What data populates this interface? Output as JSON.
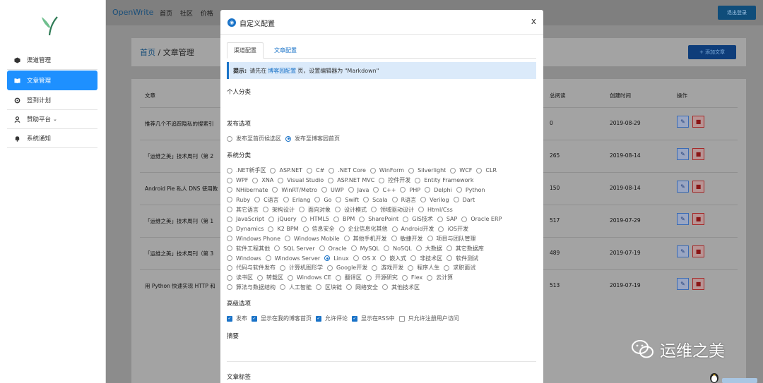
{
  "sidebar": {
    "items": [
      {
        "label": "渠道管理",
        "icon": "cube-icon"
      },
      {
        "label": "文章管理",
        "icon": "book-icon"
      },
      {
        "label": "签到计划",
        "icon": "cog-icon"
      },
      {
        "label": "赞助平台",
        "icon": "user-icon"
      },
      {
        "label": "系统通知",
        "icon": "bell-icon"
      }
    ]
  },
  "topbar": {
    "brand": "OpenWrite",
    "nav": [
      "首页",
      "社区",
      "价格"
    ],
    "logout": "退出登录"
  },
  "page": {
    "breadcrumb_home": "首页",
    "breadcrumb_sep": " / ",
    "breadcrumb_current": "文章管理",
    "add_button": "+ 添加文章"
  },
  "table": {
    "headers": {
      "title": "文章",
      "views": "总阅读",
      "created": "创建时间",
      "actions": "操作"
    },
    "rows": [
      {
        "title": "推荐几个不追踪隐私的搜索引",
        "views": "0",
        "date": "2019-08-29"
      },
      {
        "title": "「运维之美」技术周刊（第 2",
        "views": "265",
        "date": "2019-08-14"
      },
      {
        "title": "Android Pie 私人 DNS 使用教",
        "views": "150",
        "date": "2019-08-14"
      },
      {
        "title": "「运维之美」技术周刊（第 1",
        "views": "517",
        "date": "2019-07-29"
      },
      {
        "title": "「运维之美」技术周刊（第 3",
        "views": "489",
        "date": "2019-07-19"
      },
      {
        "title": "用 Python 快速实现 HTTP 和",
        "views": "513",
        "date": "2019-07-19"
      }
    ]
  },
  "modal": {
    "title": "自定义配置",
    "close": "x",
    "tabs": [
      "渠道配置",
      "文章配置"
    ],
    "tip_label": "提示:",
    "tip_pre": "请先在",
    "tip_link": "博客园配置",
    "tip_post": "页，设置编辑器为 \"Markdown\"",
    "personal_category": "个人分类",
    "publish_options": "发布选项",
    "publish_radios": [
      {
        "label": "发布至首页候选区",
        "checked": false
      },
      {
        "label": "发布至博客园首页",
        "checked": true
      }
    ],
    "system_category": "系统分类",
    "system_lines": [
      [
        ".NET新手区",
        "ASP.NET",
        "C#",
        ".NET Core",
        "WinForm",
        "Silverlight",
        "WCF",
        "CLR"
      ],
      [
        "WPF",
        "XNA",
        "Visual Studio",
        "ASP.NET MVC",
        "控件开发",
        "Entity Framework"
      ],
      [
        "NHibernate",
        "WinRT/Metro",
        "UWP",
        "Java",
        "C++",
        "PHP",
        "Delphi",
        "Python"
      ],
      [
        "Ruby",
        "C语言",
        "Erlang",
        "Go",
        "Swift",
        "Scala",
        "R语言",
        "Verilog",
        "Dart"
      ],
      [
        "其它语言",
        "架构设计",
        "面向对象",
        "设计模式",
        "领域驱动设计",
        "Html/Css"
      ],
      [
        "JavaScript",
        "jQuery",
        "HTML5",
        "BPM",
        "SharePoint",
        "GIS技术",
        "SAP",
        "Oracle ERP"
      ],
      [
        "Dynamics",
        "K2 BPM",
        "信息安全",
        "企业信息化其他",
        "Android开发",
        "iOS开发"
      ],
      [
        "Windows Phone",
        "Windows Mobile",
        "其他手机开发",
        "敏捷开发",
        "项目与团队管理"
      ],
      [
        "软件工程其他",
        "SQL Server",
        "Oracle",
        "MySQL",
        "NoSQL",
        "大数据",
        "其它数据库"
      ],
      [
        "Windows",
        "Windows Server",
        "Linux",
        "OS X",
        "嵌入式",
        "非技术区",
        "软件测试"
      ],
      [
        "代码与软件发布",
        "计算机图形学",
        "Google开发",
        "游戏开发",
        "程序人生",
        "求职面试"
      ],
      [
        "读书区",
        "转载区",
        "Windows CE",
        "翻译区",
        "开源研究",
        "Flex",
        "云计算"
      ],
      [
        "算法与数据结构",
        "人工智能",
        "区块链",
        "网络安全",
        "其他技术区"
      ]
    ],
    "system_checked": "Linux",
    "advanced": "高级选项",
    "advanced_checks": [
      {
        "label": "发布",
        "checked": true
      },
      {
        "label": "显示在我的博客首页",
        "checked": true
      },
      {
        "label": "允许评论",
        "checked": true
      },
      {
        "label": "显示在RSS中",
        "checked": true
      },
      {
        "label": "只允许注册用户访问",
        "checked": false
      }
    ],
    "summary": "摘要",
    "tags": "文章标签"
  },
  "watermark": "运维之美",
  "colors": {
    "accent": "#1a73c8",
    "active_nav": "#1e90ff"
  }
}
